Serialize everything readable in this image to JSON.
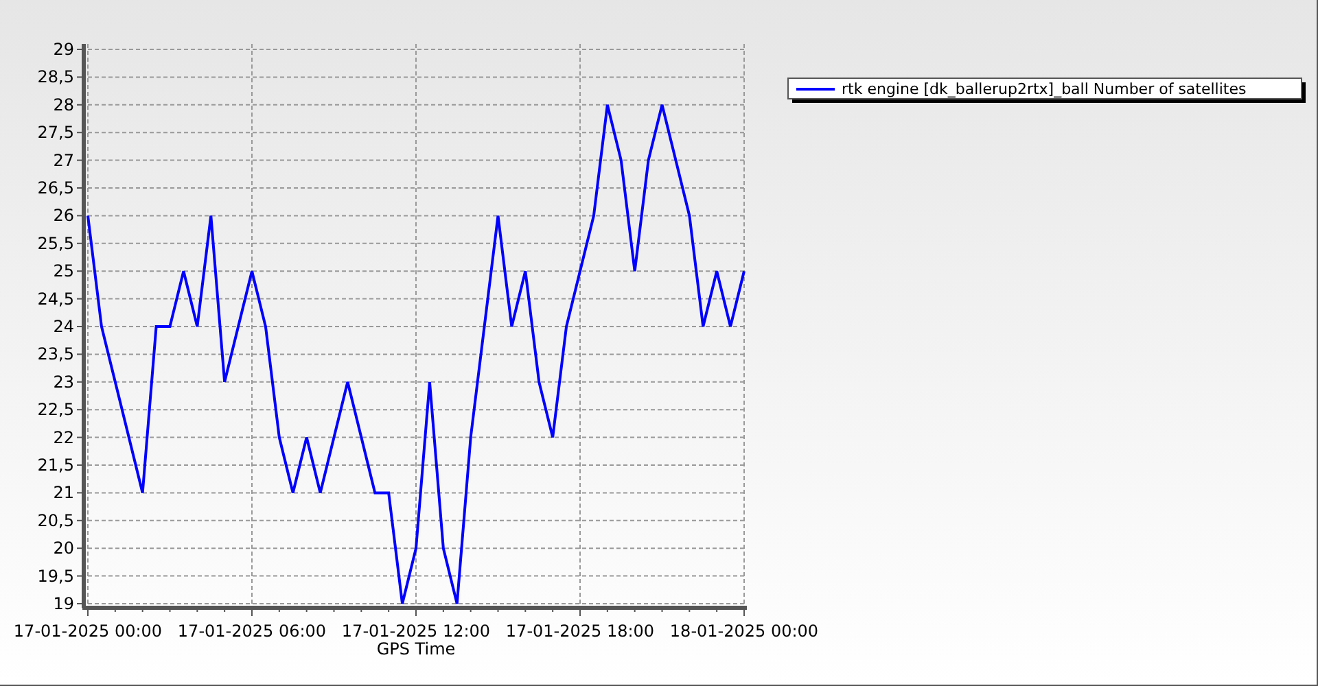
{
  "chart_data": {
    "type": "line",
    "xlabel": "GPS Time",
    "categories": [
      "17-01-2025 00:00",
      null,
      null,
      null,
      null,
      null,
      null,
      null,
      null,
      null,
      null,
      null,
      "17-01-2025 06:00",
      null,
      null,
      null,
      null,
      null,
      null,
      null,
      null,
      null,
      null,
      null,
      "17-01-2025 12:00",
      null,
      null,
      null,
      null,
      null,
      null,
      null,
      null,
      null,
      null,
      null,
      "17-01-2025 18:00",
      null,
      null,
      null,
      null,
      null,
      null,
      null,
      null,
      null,
      null,
      null,
      "18-01-2025 00:00"
    ],
    "series": [
      {
        "name": "rtk engine [dk_ballerup2rtx]_ball Number of satellites",
        "color": "#0000ff",
        "values": [
          26,
          24,
          23,
          22,
          21,
          24,
          24,
          25,
          24,
          26,
          23,
          24,
          25,
          24,
          22,
          21,
          22,
          21,
          22,
          23,
          22,
          21,
          21,
          19,
          20,
          23,
          20,
          19,
          22,
          24,
          26,
          24,
          25,
          23,
          22,
          24,
          25,
          26,
          28,
          27,
          25,
          27,
          28,
          27,
          26,
          24,
          25,
          24,
          25
        ]
      }
    ],
    "ylim": [
      19,
      29
    ],
    "grid": true,
    "yticks": [
      19,
      {
        "value": 19.5,
        "label": "19,5"
      },
      20,
      {
        "value": 20.5,
        "label": "20,5"
      },
      21,
      {
        "value": 21.5,
        "label": "21,5"
      },
      22,
      {
        "value": 22.5,
        "label": "22,5"
      },
      23,
      {
        "value": 23.5,
        "label": "23,5"
      },
      24,
      {
        "value": 24.5,
        "label": "24,5"
      },
      25,
      {
        "value": 25.5,
        "label": "25,5"
      },
      26,
      {
        "value": 26.5,
        "label": "26,5"
      },
      27,
      {
        "value": 27.5,
        "label": "27,5"
      },
      28,
      {
        "value": 28.5,
        "label": "28,5"
      },
      29
    ]
  }
}
